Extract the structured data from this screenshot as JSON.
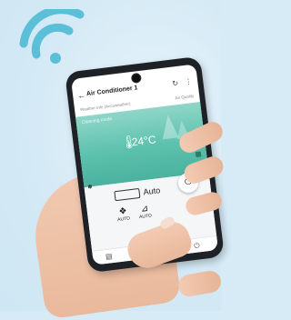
{
  "app": {
    "title": "Air Conditioner 1",
    "back_icon": "back-arrow-icon",
    "refresh_icon": "refresh-icon",
    "more_icon": "more-vertical-icon"
  },
  "info": {
    "weather_label": "Weather info (Accuweather)",
    "right_label": "Air Quality"
  },
  "hero": {
    "mode_text": "Cleaning mode",
    "temperature": "24°C",
    "colors": {
      "top": "#8fd6c8",
      "bottom": "#4ab29e"
    }
  },
  "panel": {
    "device_mode": "Auto",
    "modes": [
      {
        "label": "AUTO",
        "icon": "fan-icon"
      },
      {
        "label": "AUTO",
        "icon": "wind-direction-icon"
      }
    ]
  },
  "colors": {
    "wifi": "#5bbfd8",
    "background": "#d6ebf6"
  }
}
